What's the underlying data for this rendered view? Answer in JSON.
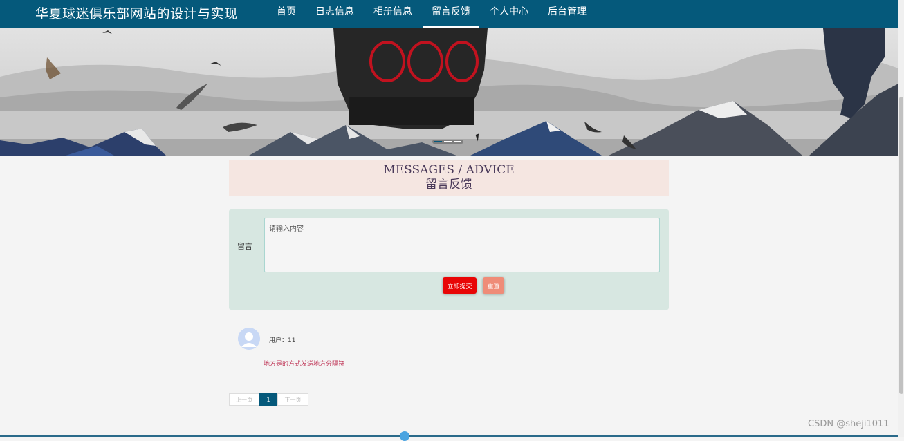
{
  "header": {
    "site_title": "华夏球迷俱乐部网站的设计与实现",
    "nav": [
      {
        "label": "首页"
      },
      {
        "label": "日志信息"
      },
      {
        "label": "相册信息"
      },
      {
        "label": "留言反馈",
        "active": true
      },
      {
        "label": "个人中心"
      },
      {
        "label": "后台管理"
      }
    ]
  },
  "banner": {
    "slide_count": 3,
    "active_slide": 1
  },
  "section": {
    "title_en": "MESSAGES / ADVICE",
    "title_cn": "留言反馈"
  },
  "form": {
    "label": "留言",
    "placeholder": "请输入内容",
    "value": "",
    "submit_label": "立即提交",
    "reset_label": "重置"
  },
  "comments": [
    {
      "user": "用户：11",
      "content": "地方是的方式发送地方分隔符"
    }
  ],
  "pagination": {
    "prev_label": "上一页",
    "current_page": "1",
    "next_label": "下一页"
  },
  "watermark": "CSDN @sheji1011",
  "colors": {
    "primary": "#05597b",
    "submit": "#e80606",
    "reset": "#ef8c78",
    "heading_bg": "#f5e6e1",
    "form_bg": "#d7e7e1",
    "comment_text": "#c0395a"
  }
}
